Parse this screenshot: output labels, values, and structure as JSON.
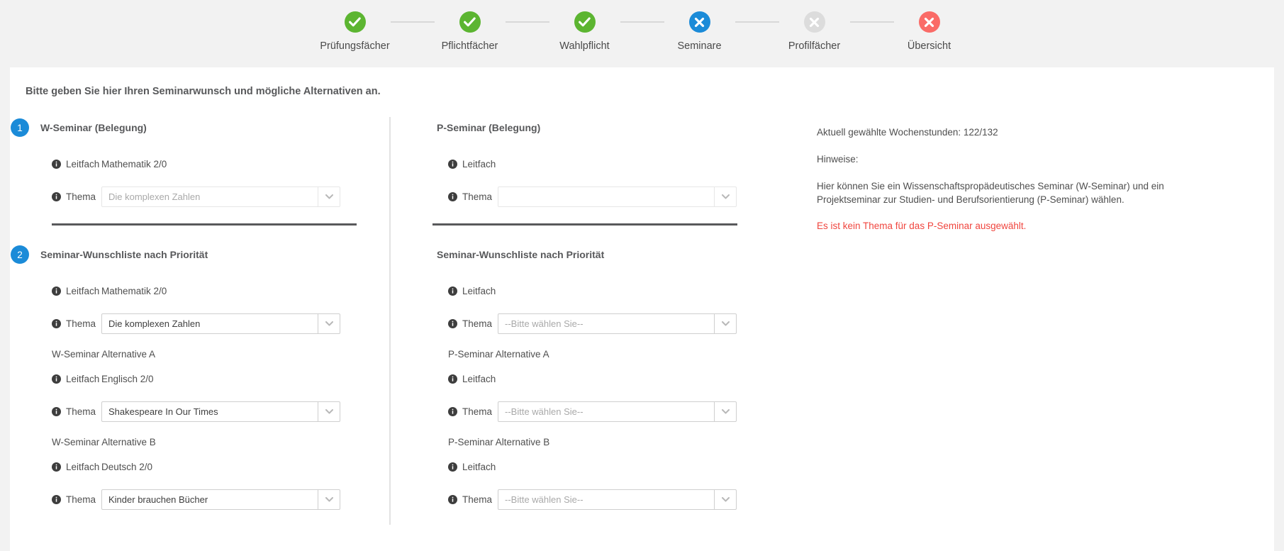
{
  "stepper": {
    "steps": [
      {
        "label": "Prüfungsfächer",
        "state": "done",
        "icon": "check-circle-icon",
        "color": "#5cb531"
      },
      {
        "label": "Pflichtfächer",
        "state": "done",
        "icon": "check-circle-icon",
        "color": "#5cb531"
      },
      {
        "label": "Wahlpflicht",
        "state": "done",
        "icon": "check-circle-icon",
        "color": "#5cb531"
      },
      {
        "label": "Seminare",
        "state": "current",
        "icon": "cross-circle-icon",
        "color": "#1b8bd8"
      },
      {
        "label": "Profilfächer",
        "state": "pending",
        "icon": "cross-circle-icon",
        "color": "#dcdcdc"
      },
      {
        "label": "Übersicht",
        "state": "error",
        "icon": "cross-circle-icon",
        "color": "#fa6b67"
      }
    ]
  },
  "intro": "Bitte geben Sie hier Ihren Seminarwunsch und mögliche Alternativen an.",
  "labels": {
    "leitfach": "Leitfach",
    "thema": "Thema"
  },
  "left": {
    "section1": {
      "badge": "1",
      "title": "W-Seminar (Belegung)",
      "leitfach": "Mathematik 2/0",
      "thema": "Die komplexen Zahlen"
    },
    "section2": {
      "badge": "2",
      "title": "Seminar-Wunschliste nach Priorität",
      "entries": [
        {
          "sub": "",
          "leitfach": "Mathematik 2/0",
          "thema": "Die komplexen Zahlen"
        },
        {
          "sub": "W-Seminar Alternative A",
          "leitfach": "Englisch 2/0",
          "thema": "Shakespeare In Our Times"
        },
        {
          "sub": "W-Seminar Alternative B",
          "leitfach": "Deutsch 2/0",
          "thema": "Kinder brauchen Bücher"
        }
      ]
    }
  },
  "right": {
    "section1": {
      "title": "P-Seminar (Belegung)",
      "leitfach": "",
      "thema": ""
    },
    "section2": {
      "title": "Seminar-Wunschliste nach Priorität",
      "entries": [
        {
          "sub": "",
          "leitfach": "",
          "thema": "--Bitte wählen Sie--"
        },
        {
          "sub": "P-Seminar Alternative A",
          "leitfach": "",
          "thema": "--Bitte wählen Sie--"
        },
        {
          "sub": "P-Seminar Alternative B",
          "leitfach": "",
          "thema": "--Bitte wählen Sie--"
        }
      ]
    }
  },
  "info": {
    "hours": "Aktuell gewählte Wochenstunden: 122/132",
    "hinweise_label": "Hinweise:",
    "hinweise_text": "Hier können Sie ein Wissenschaftspropädeutisches Seminar (W-Seminar) und ein Projektseminar zur Studien- und Berufsorientierung (P-Seminar) wählen.",
    "error": "Es ist kein Thema für das P-Seminar ausgewählt."
  },
  "colors": {
    "accent": "#1b8bd8",
    "success": "#5cb531",
    "error": "#f0453e",
    "pending": "#dcdcdc"
  }
}
